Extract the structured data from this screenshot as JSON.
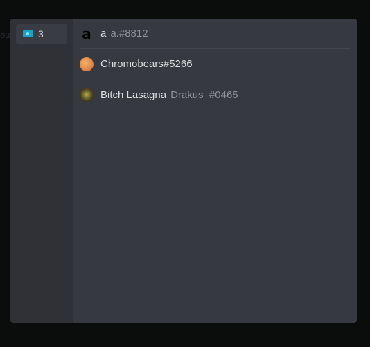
{
  "background_hint": "ou",
  "sidebar": {
    "tabs": [
      {
        "icon": "server-flag-icon",
        "count": "3"
      }
    ]
  },
  "users": [
    {
      "display_name": "a",
      "tag": "a.#8812",
      "avatar": "letter-a-avatar"
    },
    {
      "display_name": "Chromobears#5266",
      "tag": "",
      "avatar": "orange-avatar"
    },
    {
      "display_name": "Bitch Lasagna",
      "tag": "Drakus_#0465",
      "avatar": "character-avatar"
    }
  ],
  "colors": {
    "page_bg": "#0b0c0c",
    "panel_bg": "#36393f",
    "sidebar_bg": "#2f3136",
    "text_primary": "#dcddde",
    "text_muted": "#8e9297"
  }
}
